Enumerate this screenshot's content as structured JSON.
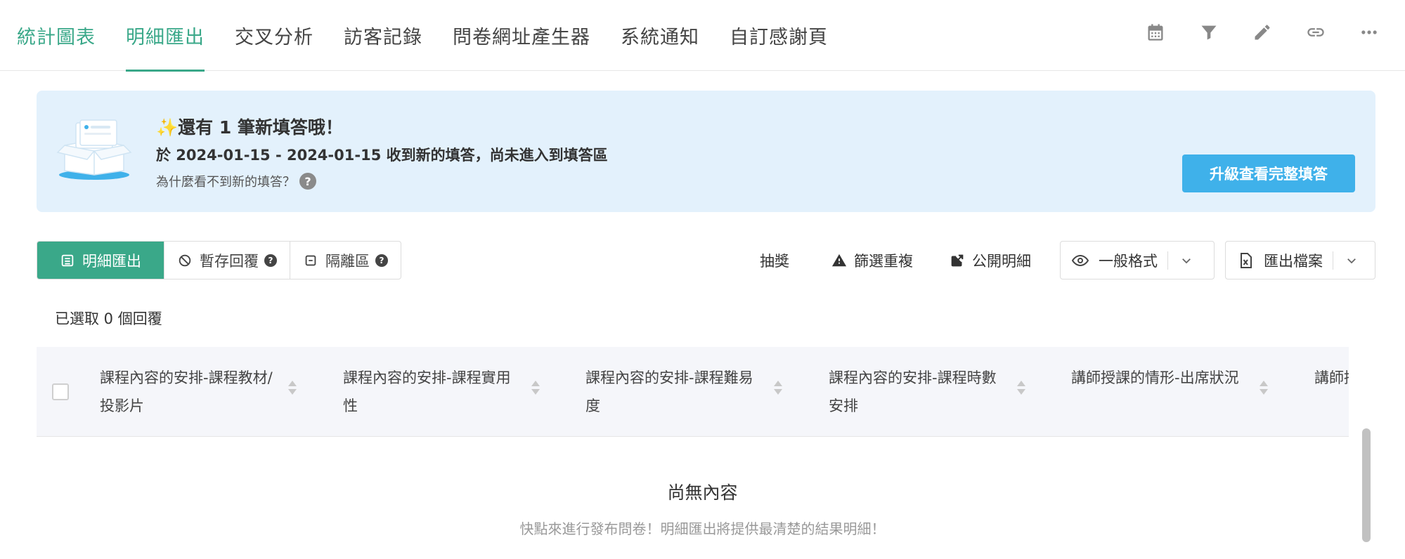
{
  "nav": {
    "tabs": [
      {
        "label": "統計圖表"
      },
      {
        "label": "明細匯出"
      },
      {
        "label": "交叉分析"
      },
      {
        "label": "訪客記錄"
      },
      {
        "label": "問卷網址產生器"
      },
      {
        "label": "系統通知"
      },
      {
        "label": "自訂感謝頁"
      }
    ],
    "active_tab": "明細匯出",
    "tool_icons": [
      "calendar-icon",
      "filter-icon",
      "pencil-icon",
      "link-icon",
      "more-icon"
    ]
  },
  "banner": {
    "title": "✨還有 1 筆新填答哦！",
    "description": "於 2024-01-15 - 2024-01-15 收到新的填答，尚未進入到填答區",
    "help_text": "為什麼看不到新的填答？",
    "help_icon": "?",
    "upgrade_button": "升級查看完整填答",
    "colors": {
      "background": "#e3f1fc",
      "button": "#3fb1ea"
    }
  },
  "toolbar": {
    "segments": [
      {
        "label": "明細匯出",
        "icon": "list-icon",
        "active": true
      },
      {
        "label": "暫存回覆",
        "icon": "ban-icon",
        "help": "?"
      },
      {
        "label": "隔離區",
        "icon": "minus-box-icon",
        "help": "?"
      }
    ],
    "actions": {
      "lottery": "抽獎",
      "filter_duplicates": "篩選重複",
      "public_details": "公開明細"
    },
    "view_format": "一般格式",
    "export_file": "匯出檔案",
    "accent": "#3aa889"
  },
  "selection": {
    "text": "已選取 0 個回覆"
  },
  "table": {
    "columns": [
      "課程內容的安排-課程教材/投影片",
      "課程內容的安排-課程實用性",
      "課程內容的安排-課程難易度",
      "課程內容的安排-課程時數安排",
      "講師授課的情形-出席狀況",
      "講師授課的情形-授課態度"
    ],
    "rows": []
  },
  "empty_state": {
    "title": "尚無內容",
    "description": "快點來進行發布問卷！明細匯出將提供最清楚的結果明細！"
  }
}
